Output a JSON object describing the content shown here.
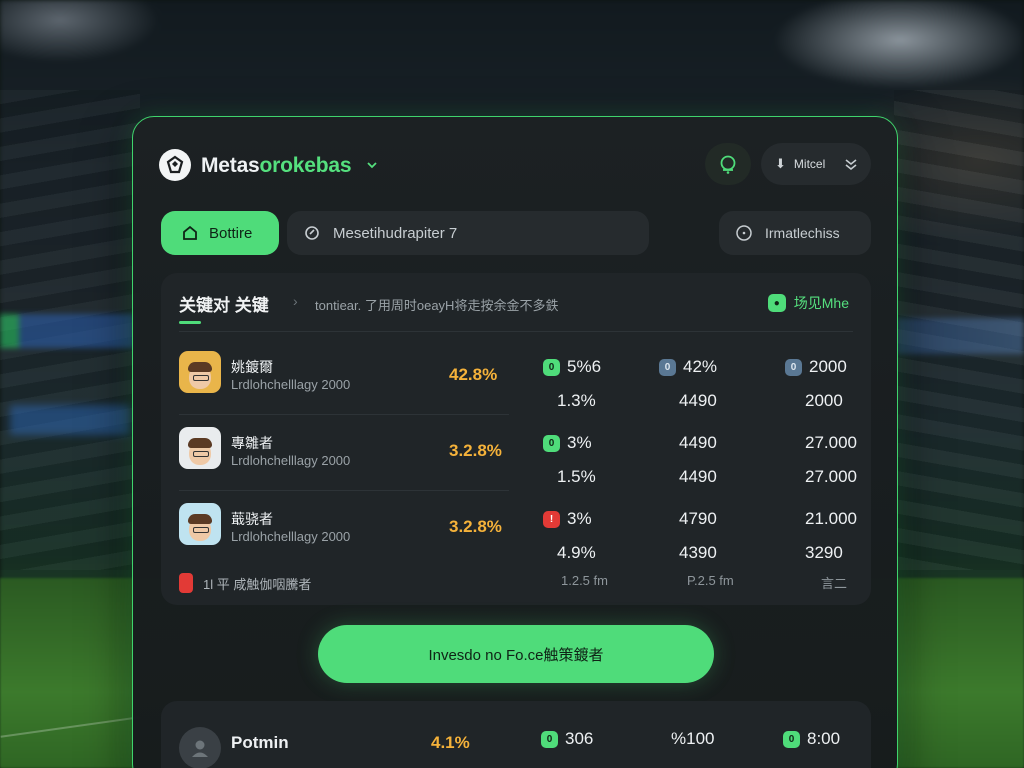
{
  "app": {
    "title_part1": "Metas",
    "title_part2": "orokebas"
  },
  "header": {
    "user_label": "Mitcel"
  },
  "toolbar": {
    "primary_label": "Bottire",
    "search_value": "Mesetihudrapiter 7",
    "filter_label": "Irmatlechiss"
  },
  "card": {
    "title": "关键对 关键",
    "subtitle": "tontiear. 了用周时oeayH将走按余金不多鉄",
    "live_label": "场见Mhe",
    "rows": [
      {
        "name": "姚鍍爾",
        "meta": "Lrdlohchelllagy 2000",
        "pct": "42.8%",
        "a1_badge": "0",
        "a1": "5%6",
        "b1_badge": "0",
        "b1": "42%",
        "c1_badge": "0",
        "c1": "2000",
        "a2": "1.3%",
        "b2": "4490",
        "c2": "2000"
      },
      {
        "name": "專雛者",
        "meta": "Lrdlohchelllagy 2000",
        "pct": "3.2.8%",
        "a1_badge": "0",
        "a1": "3%",
        "b1": "4490",
        "c1": "27.000",
        "a2": "1.5%",
        "b2": "4490",
        "c2": "27.000"
      },
      {
        "name": "蕺骁者",
        "meta": "Lrdlohchelllagy 2000",
        "pct": "3.2.8%",
        "a1_badge": "!",
        "a1": "3%",
        "b1": "4790",
        "c1": "21.000",
        "a2": "4.9%",
        "b2": "4390",
        "c2": "3290"
      }
    ],
    "footer": {
      "label": "1l 平 咸触伽咽騰者",
      "col_a": "1.2.5 fm",
      "col_b": "P.2.5 fm",
      "col_c": "言二"
    }
  },
  "cta": {
    "label": "Invesdo no Fo.ce触策鍍者"
  },
  "bottom_card": {
    "name": "Potmin",
    "pct": "4.1%",
    "a_badge": "0",
    "a": "306",
    "b": "%100",
    "c_badge": "0",
    "c": "8:00"
  },
  "colors": {
    "accent": "#4fdc7a",
    "panel": "#1c2123",
    "highlight": "#f5b23a",
    "alert": "#e23a36"
  }
}
